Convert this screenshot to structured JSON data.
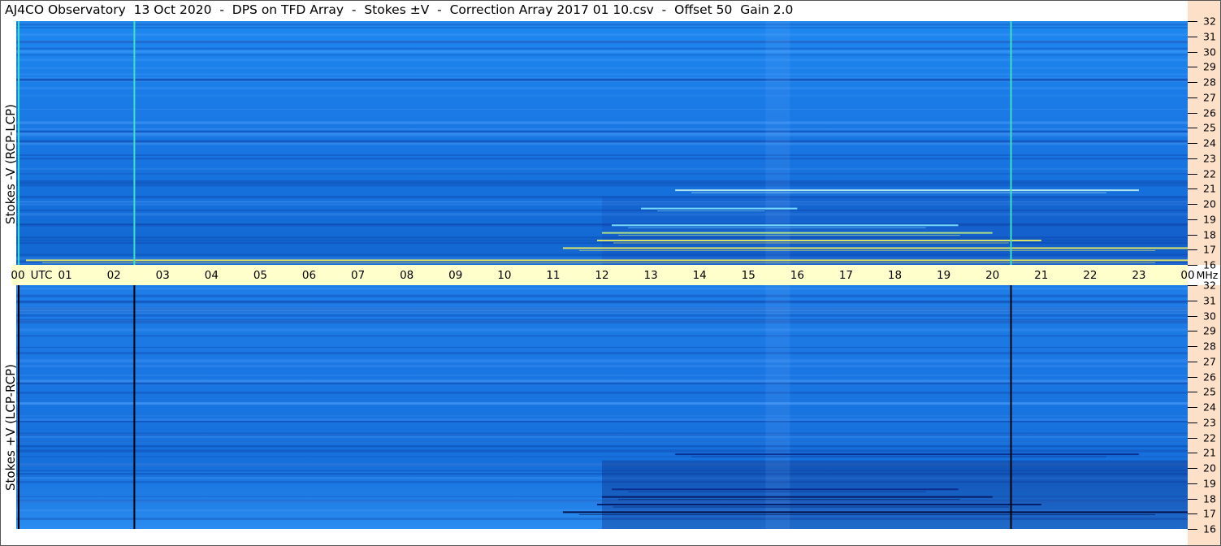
{
  "title": "AJ4CO Observatory  13 Oct 2020  -  DPS on TFD Array  -  Stokes ±V  -  Correction Array 2017 01 10.csv  -  Offset 50  Gain 2.0",
  "colors": {
    "background_blue": "#1a78e6",
    "time_bar": "#ffffcc",
    "freq_strip": "#fde0c8",
    "signal_yellow": "#f0f060",
    "dark_band": "#0a2a8a"
  },
  "chart_data": [
    {
      "type": "heatmap",
      "panel": "top",
      "ylabel": "Stokes -V (RCP-LCP)",
      "x_unit_label": "UTC",
      "y_unit_label": "MHz",
      "x_ticks": [
        "00",
        "01",
        "02",
        "03",
        "04",
        "05",
        "06",
        "07",
        "08",
        "09",
        "10",
        "11",
        "12",
        "13",
        "14",
        "15",
        "16",
        "17",
        "18",
        "19",
        "20",
        "21",
        "22",
        "23",
        "00"
      ],
      "y_ticks": [
        "16",
        "17",
        "18",
        "19",
        "20",
        "21",
        "22",
        "23",
        "24",
        "25",
        "26",
        "27",
        "28",
        "29",
        "30",
        "31",
        "32"
      ],
      "xlim": [
        0,
        24
      ],
      "ylim": [
        16,
        32
      ],
      "vertical_lines": [
        {
          "hour": 0.05,
          "color": "#40e0c0"
        },
        {
          "hour": 2.42,
          "color": "#40e0c0"
        },
        {
          "hour": 20.38,
          "color": "#40e0c0"
        }
      ],
      "signal_streaks": [
        {
          "freq": 17.1,
          "start": 11.2,
          "end": 24.0,
          "color": "#f0f060"
        },
        {
          "freq": 17.6,
          "start": 11.9,
          "end": 21.0,
          "color": "#f0f060"
        },
        {
          "freq": 18.1,
          "start": 12.0,
          "end": 20.0,
          "color": "#c0f080"
        },
        {
          "freq": 18.6,
          "start": 12.2,
          "end": 19.3,
          "color": "#80e8ff"
        },
        {
          "freq": 19.7,
          "start": 12.8,
          "end": 16.0,
          "color": "#80e8ff"
        },
        {
          "freq": 20.9,
          "start": 13.5,
          "end": 23.0,
          "color": "#c0f0f0"
        },
        {
          "freq": 16.3,
          "start": 0.2,
          "end": 24.0,
          "color": "#f0f060"
        }
      ]
    },
    {
      "type": "heatmap",
      "panel": "bottom",
      "ylabel": "Stokes +V (LCP-RCP)",
      "x_unit_label": "UTC",
      "y_unit_label": "MHz",
      "x_ticks": [
        "00",
        "01",
        "02",
        "03",
        "04",
        "05",
        "06",
        "07",
        "08",
        "09",
        "10",
        "11",
        "12",
        "13",
        "14",
        "15",
        "16",
        "17",
        "18",
        "19",
        "20",
        "21",
        "22",
        "23",
        "00"
      ],
      "y_ticks": [
        "16",
        "17",
        "18",
        "19",
        "20",
        "21",
        "22",
        "23",
        "24",
        "25",
        "26",
        "27",
        "28",
        "29",
        "30",
        "31",
        "32"
      ],
      "xlim": [
        0,
        24
      ],
      "ylim": [
        16,
        32
      ],
      "vertical_lines": [
        {
          "hour": 0.05,
          "color": "#000000"
        },
        {
          "hour": 2.42,
          "color": "#000000"
        },
        {
          "hour": 20.38,
          "color": "#000000"
        }
      ],
      "signal_streaks": [
        {
          "freq": 17.1,
          "start": 11.2,
          "end": 24.0,
          "color": "#000a40"
        },
        {
          "freq": 17.6,
          "start": 11.9,
          "end": 21.0,
          "color": "#061860"
        },
        {
          "freq": 18.1,
          "start": 12.0,
          "end": 20.0,
          "color": "#061860"
        },
        {
          "freq": 18.6,
          "start": 12.2,
          "end": 19.3,
          "color": "#0a2a8a"
        },
        {
          "freq": 20.9,
          "start": 13.5,
          "end": 23.0,
          "color": "#0a2a8a"
        }
      ]
    }
  ]
}
